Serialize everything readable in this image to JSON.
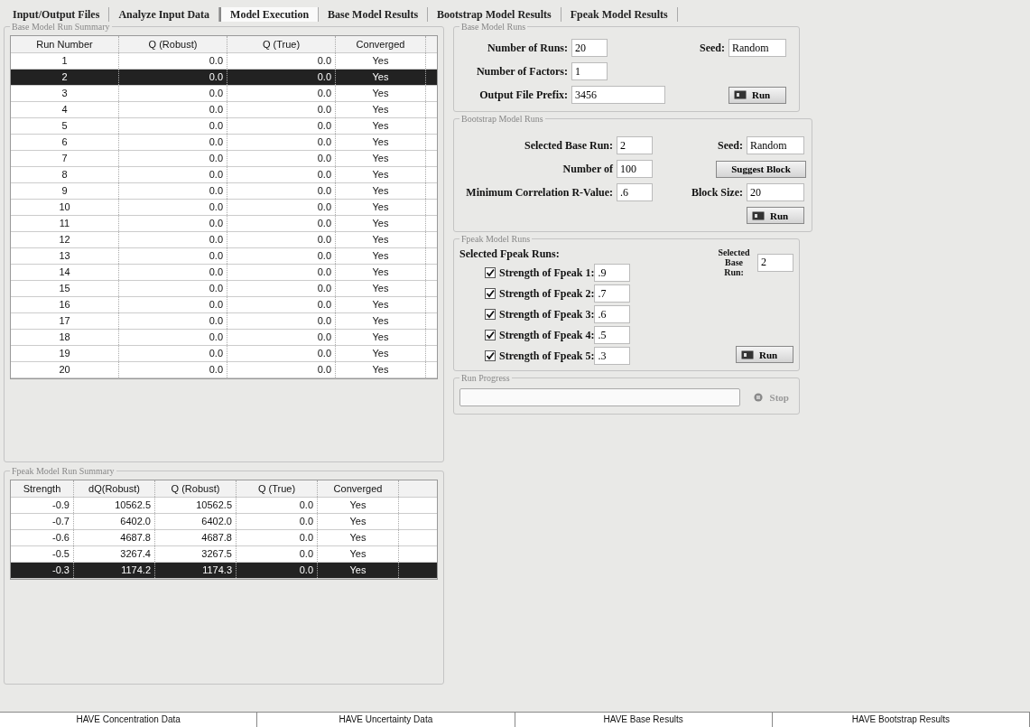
{
  "tabs": [
    {
      "label": "Input/Output Files",
      "selected": false
    },
    {
      "label": "Analyze Input Data",
      "selected": false
    },
    {
      "label": "Model Execution",
      "selected": true
    },
    {
      "label": "Base Model Results",
      "selected": false
    },
    {
      "label": "Bootstrap Model Results",
      "selected": false
    },
    {
      "label": "Fpeak Model Results",
      "selected": false
    }
  ],
  "base_summary": {
    "title": "Base Model Run Summary",
    "columns": [
      "Run Number",
      "Q (Robust)",
      "Q (True)",
      "Converged"
    ],
    "rows": [
      {
        "cells": [
          "1",
          "0.0",
          "0.0",
          "Yes"
        ],
        "selected": false
      },
      {
        "cells": [
          "2",
          "0.0",
          "0.0",
          "Yes"
        ],
        "selected": true
      },
      {
        "cells": [
          "3",
          "0.0",
          "0.0",
          "Yes"
        ],
        "selected": false
      },
      {
        "cells": [
          "4",
          "0.0",
          "0.0",
          "Yes"
        ],
        "selected": false
      },
      {
        "cells": [
          "5",
          "0.0",
          "0.0",
          "Yes"
        ],
        "selected": false
      },
      {
        "cells": [
          "6",
          "0.0",
          "0.0",
          "Yes"
        ],
        "selected": false
      },
      {
        "cells": [
          "7",
          "0.0",
          "0.0",
          "Yes"
        ],
        "selected": false
      },
      {
        "cells": [
          "8",
          "0.0",
          "0.0",
          "Yes"
        ],
        "selected": false
      },
      {
        "cells": [
          "9",
          "0.0",
          "0.0",
          "Yes"
        ],
        "selected": false
      },
      {
        "cells": [
          "10",
          "0.0",
          "0.0",
          "Yes"
        ],
        "selected": false
      },
      {
        "cells": [
          "11",
          "0.0",
          "0.0",
          "Yes"
        ],
        "selected": false
      },
      {
        "cells": [
          "12",
          "0.0",
          "0.0",
          "Yes"
        ],
        "selected": false
      },
      {
        "cells": [
          "13",
          "0.0",
          "0.0",
          "Yes"
        ],
        "selected": false
      },
      {
        "cells": [
          "14",
          "0.0",
          "0.0",
          "Yes"
        ],
        "selected": false
      },
      {
        "cells": [
          "15",
          "0.0",
          "0.0",
          "Yes"
        ],
        "selected": false
      },
      {
        "cells": [
          "16",
          "0.0",
          "0.0",
          "Yes"
        ],
        "selected": false
      },
      {
        "cells": [
          "17",
          "0.0",
          "0.0",
          "Yes"
        ],
        "selected": false
      },
      {
        "cells": [
          "18",
          "0.0",
          "0.0",
          "Yes"
        ],
        "selected": false
      },
      {
        "cells": [
          "19",
          "0.0",
          "0.0",
          "Yes"
        ],
        "selected": false
      },
      {
        "cells": [
          "20",
          "0.0",
          "0.0",
          "Yes"
        ],
        "selected": false
      }
    ]
  },
  "fpeak_summary": {
    "title": "Fpeak Model Run Summary",
    "columns": [
      "Strength",
      "dQ(Robust)",
      "Q (Robust)",
      "Q (True)",
      "Converged"
    ],
    "rows": [
      {
        "cells": [
          "-0.9",
          "10562.5",
          "10562.5",
          "0.0",
          "Yes"
        ],
        "selected": false
      },
      {
        "cells": [
          "-0.7",
          "6402.0",
          "6402.0",
          "0.0",
          "Yes"
        ],
        "selected": false
      },
      {
        "cells": [
          "-0.6",
          "4687.8",
          "4687.8",
          "0.0",
          "Yes"
        ],
        "selected": false
      },
      {
        "cells": [
          "-0.5",
          "3267.4",
          "3267.5",
          "0.0",
          "Yes"
        ],
        "selected": false
      },
      {
        "cells": [
          "-0.3",
          "1174.2",
          "1174.3",
          "0.0",
          "Yes"
        ],
        "selected": true
      }
    ]
  },
  "base_runs": {
    "title": "Base Model Runs",
    "runs_label": "Number of Runs:",
    "runs": "20",
    "seed_label": "Seed:",
    "seed": "Random",
    "factors_label": "Number of Factors:",
    "factors": "1",
    "prefix_label": "Output File Prefix:",
    "prefix": "3456",
    "run_button": "Run"
  },
  "bootstrap_runs": {
    "title": "Bootstrap Model Runs",
    "base_run_label": "Selected Base Run:",
    "base_run": "2",
    "seed_label": "Seed:",
    "seed": "Random",
    "number_label": "Number of",
    "number": "100",
    "suggest_button": "Suggest Block",
    "corr_label": "Minimum Correlation R-Value:",
    "corr": ".6",
    "block_label": "Block Size:",
    "block": "20",
    "run_button": "Run"
  },
  "fpeak_runs": {
    "title": "Fpeak Model Runs",
    "selected_label": "Selected Fpeak Runs:",
    "base_run_label": "Selected Base Run:",
    "base_run": "2",
    "run_button": "Run",
    "strengths": [
      {
        "label": "Strength of Fpeak 1:",
        "value": ".9",
        "checked": true
      },
      {
        "label": "Strength of Fpeak 2:",
        "value": ".7",
        "checked": true
      },
      {
        "label": "Strength of Fpeak 3:",
        "value": ".6",
        "checked": true
      },
      {
        "label": "Strength of Fpeak 4:",
        "value": ".5",
        "checked": true
      },
      {
        "label": "Strength of Fpeak 5:",
        "value": ".3",
        "checked": true
      }
    ]
  },
  "run_progress": {
    "title": "Run Progress",
    "stop_button": "Stop",
    "stop_disabled": true
  },
  "status_bar": [
    "HAVE Concentration Data",
    "HAVE Uncertainty Data",
    "HAVE Base Results",
    "HAVE Bootstrap Results"
  ]
}
